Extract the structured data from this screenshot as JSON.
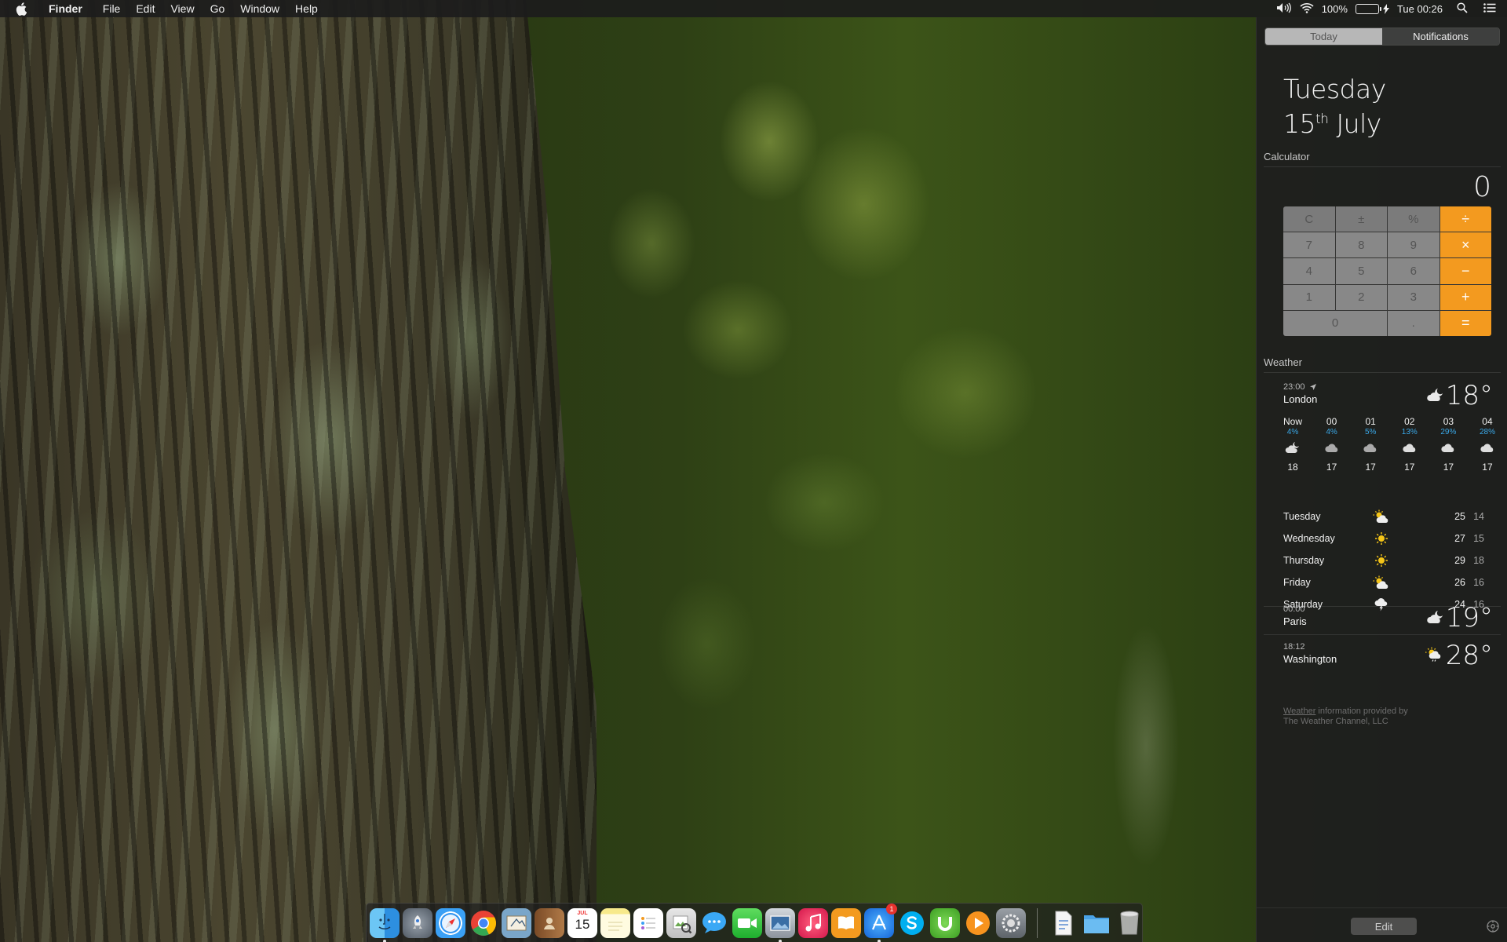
{
  "menubar": {
    "app_name": "Finder",
    "menus": [
      "File",
      "Edit",
      "View",
      "Go",
      "Window",
      "Help"
    ],
    "battery_percent": "100%",
    "battery_level": 1.0,
    "clock": "Tue 00:26",
    "icons": [
      "apple-icon",
      "volume-icon",
      "wifi-icon",
      "battery-icon",
      "spotlight-icon",
      "notification-center-icon"
    ]
  },
  "notification_center": {
    "tabs": {
      "today": "Today",
      "notifications": "Notifications"
    },
    "active_tab": "Today",
    "date": {
      "weekday": "Tuesday",
      "day": "15",
      "suffix": "th",
      "month": "July"
    },
    "calculator": {
      "label": "Calculator",
      "display": "0",
      "keys": [
        "C",
        "±",
        "%",
        "÷",
        "7",
        "8",
        "9",
        "×",
        "4",
        "5",
        "6",
        "−",
        "1",
        "2",
        "3",
        "+",
        "0",
        ".",
        "="
      ],
      "operator_color": "#f39a1f"
    },
    "weather": {
      "label": "Weather",
      "primary": {
        "time": "23:00",
        "city": "London",
        "temp": "18°",
        "icon": "partly-cloudy-night-icon",
        "hourly": [
          {
            "hour": "Now",
            "precip": "4%",
            "icon": "cloudy-night-icon",
            "temp": "18"
          },
          {
            "hour": "00",
            "precip": "4%",
            "icon": "cloud-icon",
            "temp": "17"
          },
          {
            "hour": "01",
            "precip": "5%",
            "icon": "cloud-icon",
            "temp": "17"
          },
          {
            "hour": "02",
            "precip": "13%",
            "icon": "cloud-icon",
            "temp": "17"
          },
          {
            "hour": "03",
            "precip": "29%",
            "icon": "cloud-icon",
            "temp": "17"
          },
          {
            "hour": "04",
            "precip": "28%",
            "icon": "cloud-icon",
            "temp": "17"
          }
        ],
        "daily": [
          {
            "day": "Tuesday",
            "icon": "partly-sunny-icon",
            "high": "25",
            "low": "14"
          },
          {
            "day": "Wednesday",
            "icon": "sun-icon",
            "high": "27",
            "low": "15"
          },
          {
            "day": "Thursday",
            "icon": "sun-icon",
            "high": "29",
            "low": "18"
          },
          {
            "day": "Friday",
            "icon": "partly-sunny-icon",
            "high": "26",
            "low": "16"
          },
          {
            "day": "Saturday",
            "icon": "thunderstorm-icon",
            "high": "24",
            "low": "16"
          }
        ]
      },
      "cities": [
        {
          "time": "00:00",
          "city": "Paris",
          "temp": "19°",
          "icon": "partly-cloudy-night-icon"
        },
        {
          "time": "18:12",
          "city": "Washington",
          "temp": "28°",
          "icon": "sun-rain-icon"
        }
      ],
      "credit_link": "Weather",
      "credit_text": " information provided by",
      "credit_line2": "The Weather Channel, LLC",
      "precip_color": "#3aa8e8"
    },
    "edit_label": "Edit"
  },
  "dock": {
    "apps": [
      {
        "name": "Finder",
        "icon": "finder-icon",
        "running": true
      },
      {
        "name": "Launchpad",
        "icon": "launchpad-icon",
        "running": false
      },
      {
        "name": "Safari",
        "icon": "safari-icon",
        "running": false
      },
      {
        "name": "Chrome",
        "icon": "chrome-icon",
        "running": false
      },
      {
        "name": "Mail",
        "icon": "mail-icon",
        "running": false
      },
      {
        "name": "Contacts",
        "icon": "contacts-icon",
        "running": false
      },
      {
        "name": "Calendar",
        "icon": "calendar-icon",
        "running": false,
        "month": "JUL",
        "day": "15"
      },
      {
        "name": "Notes",
        "icon": "notes-icon",
        "running": false
      },
      {
        "name": "Reminders",
        "icon": "reminders-icon",
        "running": false
      },
      {
        "name": "Preview",
        "icon": "preview-icon",
        "running": false
      },
      {
        "name": "Messages",
        "icon": "messages-icon",
        "running": false
      },
      {
        "name": "FaceTime",
        "icon": "facetime-icon",
        "running": false
      },
      {
        "name": "Photo Viewer",
        "icon": "photos-icon",
        "running": true
      },
      {
        "name": "iTunes",
        "icon": "itunes-icon",
        "running": false
      },
      {
        "name": "iBooks",
        "icon": "ibooks-icon",
        "running": false
      },
      {
        "name": "App Store",
        "icon": "app-store-icon",
        "running": true,
        "badge": "1"
      },
      {
        "name": "Skype",
        "icon": "skype-icon",
        "running": false
      },
      {
        "name": "uTorrent",
        "icon": "utorrent-icon",
        "running": false
      },
      {
        "name": "Infuse",
        "icon": "play-icon",
        "running": false
      },
      {
        "name": "System Preferences",
        "icon": "system-preferences-icon",
        "running": false
      }
    ],
    "stacks": [
      {
        "name": "Documents",
        "icon": "document-stack-icon"
      },
      {
        "name": "Folder",
        "icon": "folder-icon"
      },
      {
        "name": "Trash",
        "icon": "trash-icon"
      }
    ]
  }
}
